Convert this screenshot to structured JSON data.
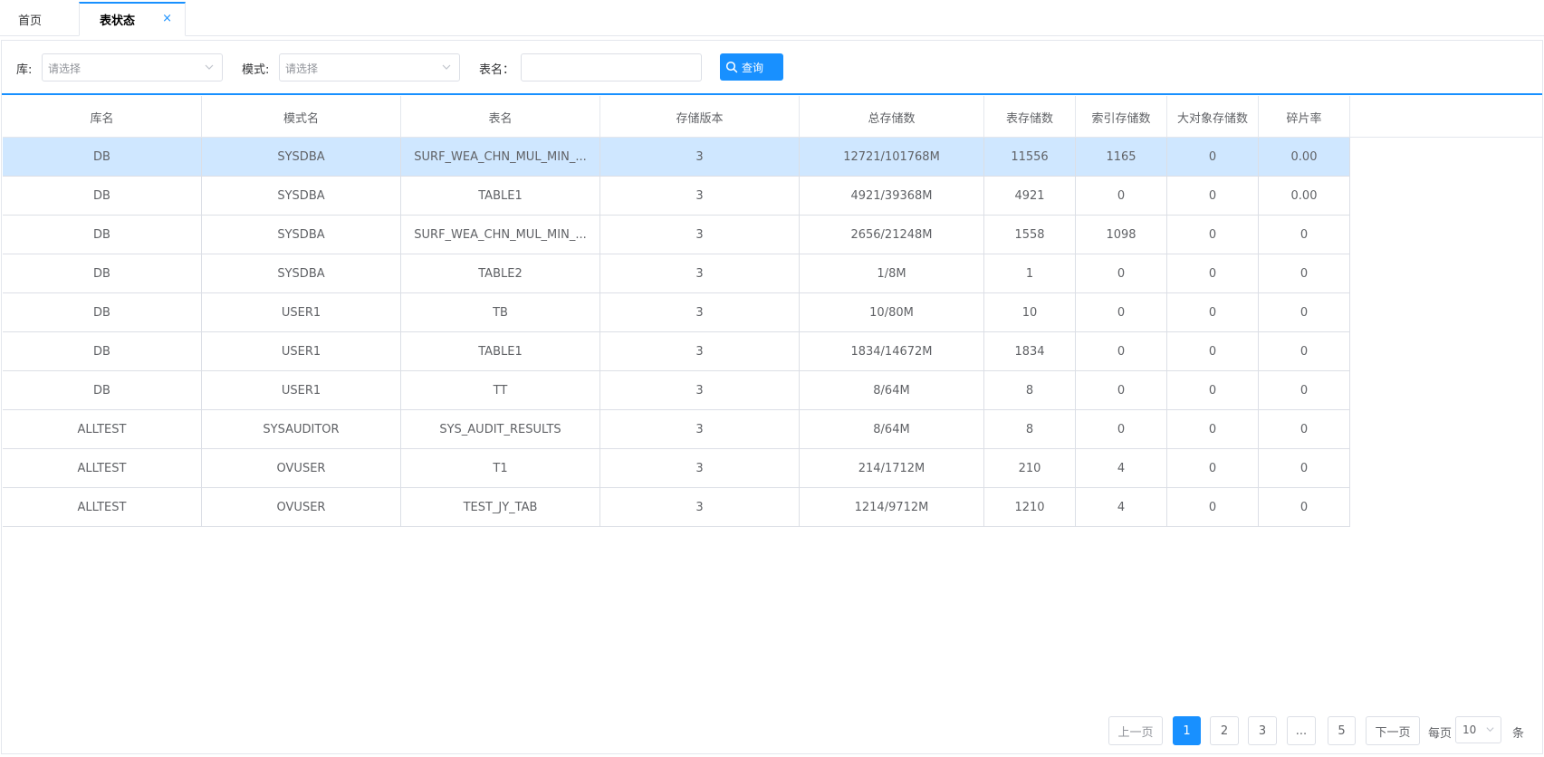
{
  "tabs": {
    "home": "首页",
    "active": "表状态",
    "close": "×"
  },
  "filters": {
    "db_label": "库:",
    "db_placeholder": "请选择",
    "schema_label": "模式:",
    "schema_placeholder": "请选择",
    "table_label": "表名：",
    "table_value": "",
    "query_label": "查询"
  },
  "table": {
    "headers": [
      "库名",
      "模式名",
      "表名",
      "存储版本",
      "总存储数",
      "表存储数",
      "索引存储数",
      "大对象存储数",
      "碎片率"
    ],
    "rows": [
      [
        "DB",
        "SYSDBA",
        "SURF_WEA_CHN_MUL_MIN_...",
        "3",
        "12721/101768M",
        "11556",
        "1165",
        "0",
        "0.00"
      ],
      [
        "DB",
        "SYSDBA",
        "TABLE1",
        "3",
        "4921/39368M",
        "4921",
        "0",
        "0",
        "0.00"
      ],
      [
        "DB",
        "SYSDBA",
        "SURF_WEA_CHN_MUL_MIN_...",
        "3",
        "2656/21248M",
        "1558",
        "1098",
        "0",
        "0"
      ],
      [
        "DB",
        "SYSDBA",
        "TABLE2",
        "3",
        "1/8M",
        "1",
        "0",
        "0",
        "0"
      ],
      [
        "DB",
        "USER1",
        "TB",
        "3",
        "10/80M",
        "10",
        "0",
        "0",
        "0"
      ],
      [
        "DB",
        "USER1",
        "TABLE1",
        "3",
        "1834/14672M",
        "1834",
        "0",
        "0",
        "0"
      ],
      [
        "DB",
        "USER1",
        "TT",
        "3",
        "8/64M",
        "8",
        "0",
        "0",
        "0"
      ],
      [
        "ALLTEST",
        "SYSAUDITOR",
        "SYS_AUDIT_RESULTS",
        "3",
        "8/64M",
        "8",
        "0",
        "0",
        "0"
      ],
      [
        "ALLTEST",
        "OVUSER",
        "T1",
        "3",
        "214/1712M",
        "210",
        "4",
        "0",
        "0"
      ],
      [
        "ALLTEST",
        "OVUSER",
        "TEST_JY_TAB",
        "3",
        "1214/9712M",
        "1210",
        "4",
        "0",
        "0"
      ]
    ]
  },
  "pagination": {
    "prev": "上一页",
    "pages": [
      "1",
      "2",
      "3",
      "...",
      "5"
    ],
    "current": "1",
    "next": "下一页",
    "per_page_label": "每页",
    "per_page_value": "10",
    "unit": "条"
  },
  "colors": {
    "accent": "#1890ff",
    "selected_row": "#cfe7ff"
  }
}
